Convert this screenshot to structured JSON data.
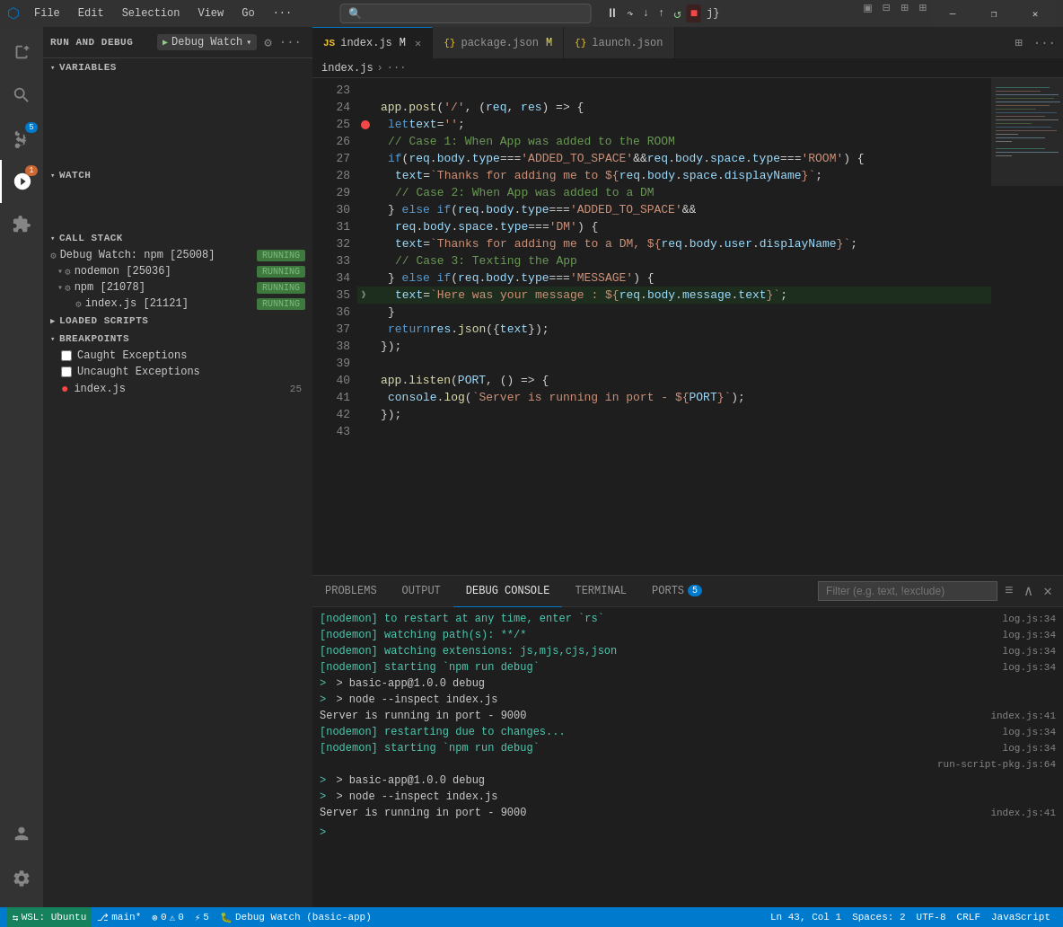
{
  "titleBar": {
    "appIcon": "⬡",
    "menuItems": [
      "File",
      "Edit",
      "Selection",
      "View",
      "Go",
      "···"
    ],
    "windowControls": [
      "—",
      "❐",
      "✕"
    ]
  },
  "sidebar": {
    "runDebugTitle": "RUN AND DEBUG",
    "debugConfig": "Debug Watch",
    "sections": {
      "variables": "VARIABLES",
      "watch": "WATCH",
      "callStack": "CALL STACK",
      "loadedScripts": "LOADED SCRIPTS",
      "breakpoints": "BREAKPOINTS"
    },
    "callStackItems": [
      {
        "label": "Debug Watch: npm [25008]",
        "status": "RUNNING",
        "level": 0
      },
      {
        "label": "nodemon [25036]",
        "status": "RUNNING",
        "level": 1
      },
      {
        "label": "npm [21078]",
        "status": "RUNNING",
        "level": 1
      },
      {
        "label": "index.js [21121]",
        "status": "RUNNING",
        "level": 2
      }
    ],
    "breakpoints": [
      {
        "type": "checkbox",
        "label": "Caught Exceptions",
        "checked": false
      },
      {
        "type": "checkbox",
        "label": "Uncaught Exceptions",
        "checked": false
      },
      {
        "type": "file",
        "label": "index.js",
        "line": 25
      }
    ]
  },
  "tabs": [
    {
      "label": "index.js",
      "icon": "JS",
      "active": true,
      "modified": true,
      "close": true
    },
    {
      "label": "package.json",
      "icon": "{}",
      "active": false,
      "modified": true,
      "close": false
    },
    {
      "label": "launch.json",
      "icon": "{}",
      "active": false,
      "modified": false,
      "close": false
    }
  ],
  "breadcrumb": {
    "path": [
      "index.js",
      "···"
    ]
  },
  "codeLines": [
    {
      "num": 23,
      "content": "",
      "breakpoint": false
    },
    {
      "num": 24,
      "content": "  app.post('/', (req, res) => {",
      "breakpoint": false
    },
    {
      "num": 25,
      "content": "    let text = '';",
      "breakpoint": true
    },
    {
      "num": 26,
      "content": "    // Case 1: When App was added to the ROOM",
      "breakpoint": false
    },
    {
      "num": 27,
      "content": "    if (req.body.type === 'ADDED_TO_SPACE' && req.body.space.type === 'ROOM') {",
      "breakpoint": false
    },
    {
      "num": 28,
      "content": "      text = `Thanks for adding me to ${req.body.space.displayName}`;",
      "breakpoint": false
    },
    {
      "num": 29,
      "content": "      // Case 2: When App was added to a DM",
      "breakpoint": false
    },
    {
      "num": 30,
      "content": "    } else if (req.body.type === 'ADDED_TO_SPACE' &&",
      "breakpoint": false
    },
    {
      "num": 31,
      "content": "      req.body.space.type === 'DM') {",
      "breakpoint": false
    },
    {
      "num": 32,
      "content": "      text = `Thanks for adding me to a DM, ${req.body.user.displayName}`;",
      "breakpoint": false
    },
    {
      "num": 33,
      "content": "      // Case 3: Texting the App",
      "breakpoint": false
    },
    {
      "num": 34,
      "content": "    } else if (req.body.type === 'MESSAGE') {",
      "breakpoint": false
    },
    {
      "num": 35,
      "content": "      text = `Here was your message : ${req.body.message.text}`;",
      "breakpoint": false
    },
    {
      "num": 36,
      "content": "    }",
      "breakpoint": false
    },
    {
      "num": 37,
      "content": "    return res.json({text});",
      "breakpoint": false
    },
    {
      "num": 38,
      "content": "  });",
      "breakpoint": false
    },
    {
      "num": 39,
      "content": "",
      "breakpoint": false
    },
    {
      "num": 40,
      "content": "  app.listen(PORT, () => {",
      "breakpoint": false
    },
    {
      "num": 41,
      "content": "    console.log(`Server is running in port - ${PORT}`);",
      "breakpoint": false
    },
    {
      "num": 42,
      "content": "  });",
      "breakpoint": false
    },
    {
      "num": 43,
      "content": "",
      "breakpoint": false
    }
  ],
  "bottomPanel": {
    "tabs": [
      "PROBLEMS",
      "OUTPUT",
      "DEBUG CONSOLE",
      "TERMINAL",
      "PORTS"
    ],
    "portsCount": "5",
    "activeTab": "DEBUG CONSOLE",
    "filterPlaceholder": "Filter (e.g. text, !exclude)",
    "consoleLines": [
      {
        "text": "[nodemon] to restart at any time, enter `rs`",
        "source": "log.js:34",
        "color": "green"
      },
      {
        "text": "[nodemon] watching path(s): **/*",
        "source": "log.js:34",
        "color": "green"
      },
      {
        "text": "[nodemon] watching extensions: js,mjs,cjs,json",
        "source": "log.js:34",
        "color": "green"
      },
      {
        "text": "[nodemon] starting `npm run debug`",
        "source": "log.js:34",
        "color": "green"
      },
      {
        "text": "> basic-app@1.0.0 debug",
        "source": "",
        "color": "white",
        "arrow": true
      },
      {
        "text": "> node --inspect index.js",
        "source": "",
        "color": "white",
        "arrow": true
      },
      {
        "text": "Server is running in port - 9000",
        "source": "index.js:41",
        "color": "white"
      },
      {
        "text": "[nodemon] restarting due to changes...",
        "source": "log.js:34",
        "color": "green"
      },
      {
        "text": "[nodemon] starting `npm run debug`",
        "source": "log.js:34",
        "color": "green"
      },
      {
        "text": "",
        "source": "run-script-pkg.js:64",
        "color": "white"
      },
      {
        "text": "> basic-app@1.0.0 debug",
        "source": "",
        "color": "white",
        "arrow": true
      },
      {
        "text": "> node --inspect index.js",
        "source": "",
        "color": "white",
        "arrow": true
      },
      {
        "text": "Server is running in port - 9000",
        "source": "index.js:41",
        "color": "white"
      }
    ]
  },
  "statusBar": {
    "remote": "WSL: Ubuntu",
    "branch": "main*",
    "errors": "0",
    "warnings": "0",
    "debugPorts": "5",
    "debugName": "Debug Watch (basic-app)",
    "position": "Ln 43, Col 1",
    "spaces": "Spaces: 2",
    "encoding": "UTF-8",
    "lineEnding": "CRLF",
    "language": "JavaScript"
  }
}
